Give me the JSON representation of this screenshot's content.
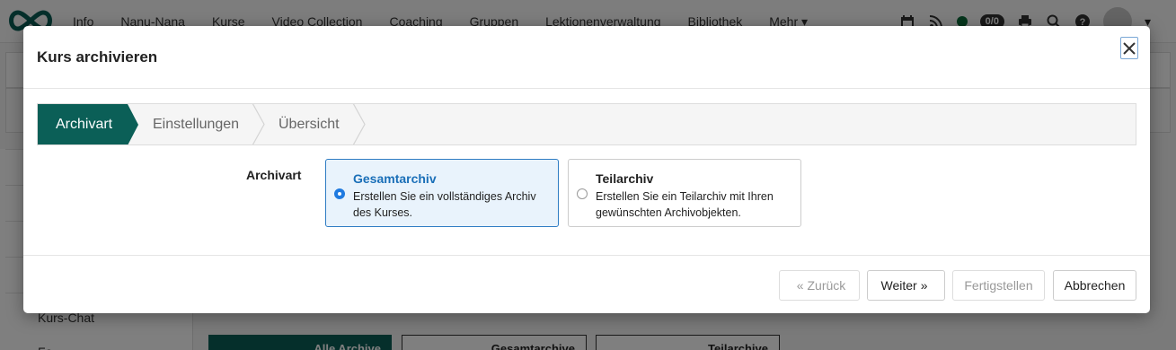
{
  "nav": {
    "items": [
      "Info",
      "Nanu-Nana",
      "Kurse",
      "Video Collection",
      "Coaching",
      "Gruppen",
      "Lektionenverwaltung",
      "Bibliothek",
      "Mehr"
    ],
    "badge": "0/0"
  },
  "background": {
    "sidebar_labels": [
      "Kurs-Chat",
      "Fo"
    ],
    "buttons": [
      "Alle Archive",
      "Gesamtarchive",
      "Teilarchive"
    ]
  },
  "modal": {
    "title": "Kurs archivieren",
    "steps": [
      "Archivart",
      "Einstellungen",
      "Übersicht"
    ],
    "form_label": "Archivart",
    "options": [
      {
        "title": "Gesamtarchiv",
        "desc_line1": "Erstellen Sie ein vollständiges Archiv",
        "desc_line2": "des Kurses.",
        "selected": true
      },
      {
        "title": "Teilarchiv",
        "desc_line1": "Erstellen Sie ein Teilarchiv mit Ihren",
        "desc_line2": "gewünschten Archivobjekten.",
        "selected": false
      }
    ],
    "footer": {
      "back": "Zurück",
      "next": "Weiter",
      "finish": "Fertigstellen",
      "cancel": "Abbrechen"
    }
  },
  "colors": {
    "accent": "#0b5f57",
    "selected_border": "#2e7cc3",
    "selected_bg": "#e9f3fc",
    "radio": "#1f7ae0"
  }
}
